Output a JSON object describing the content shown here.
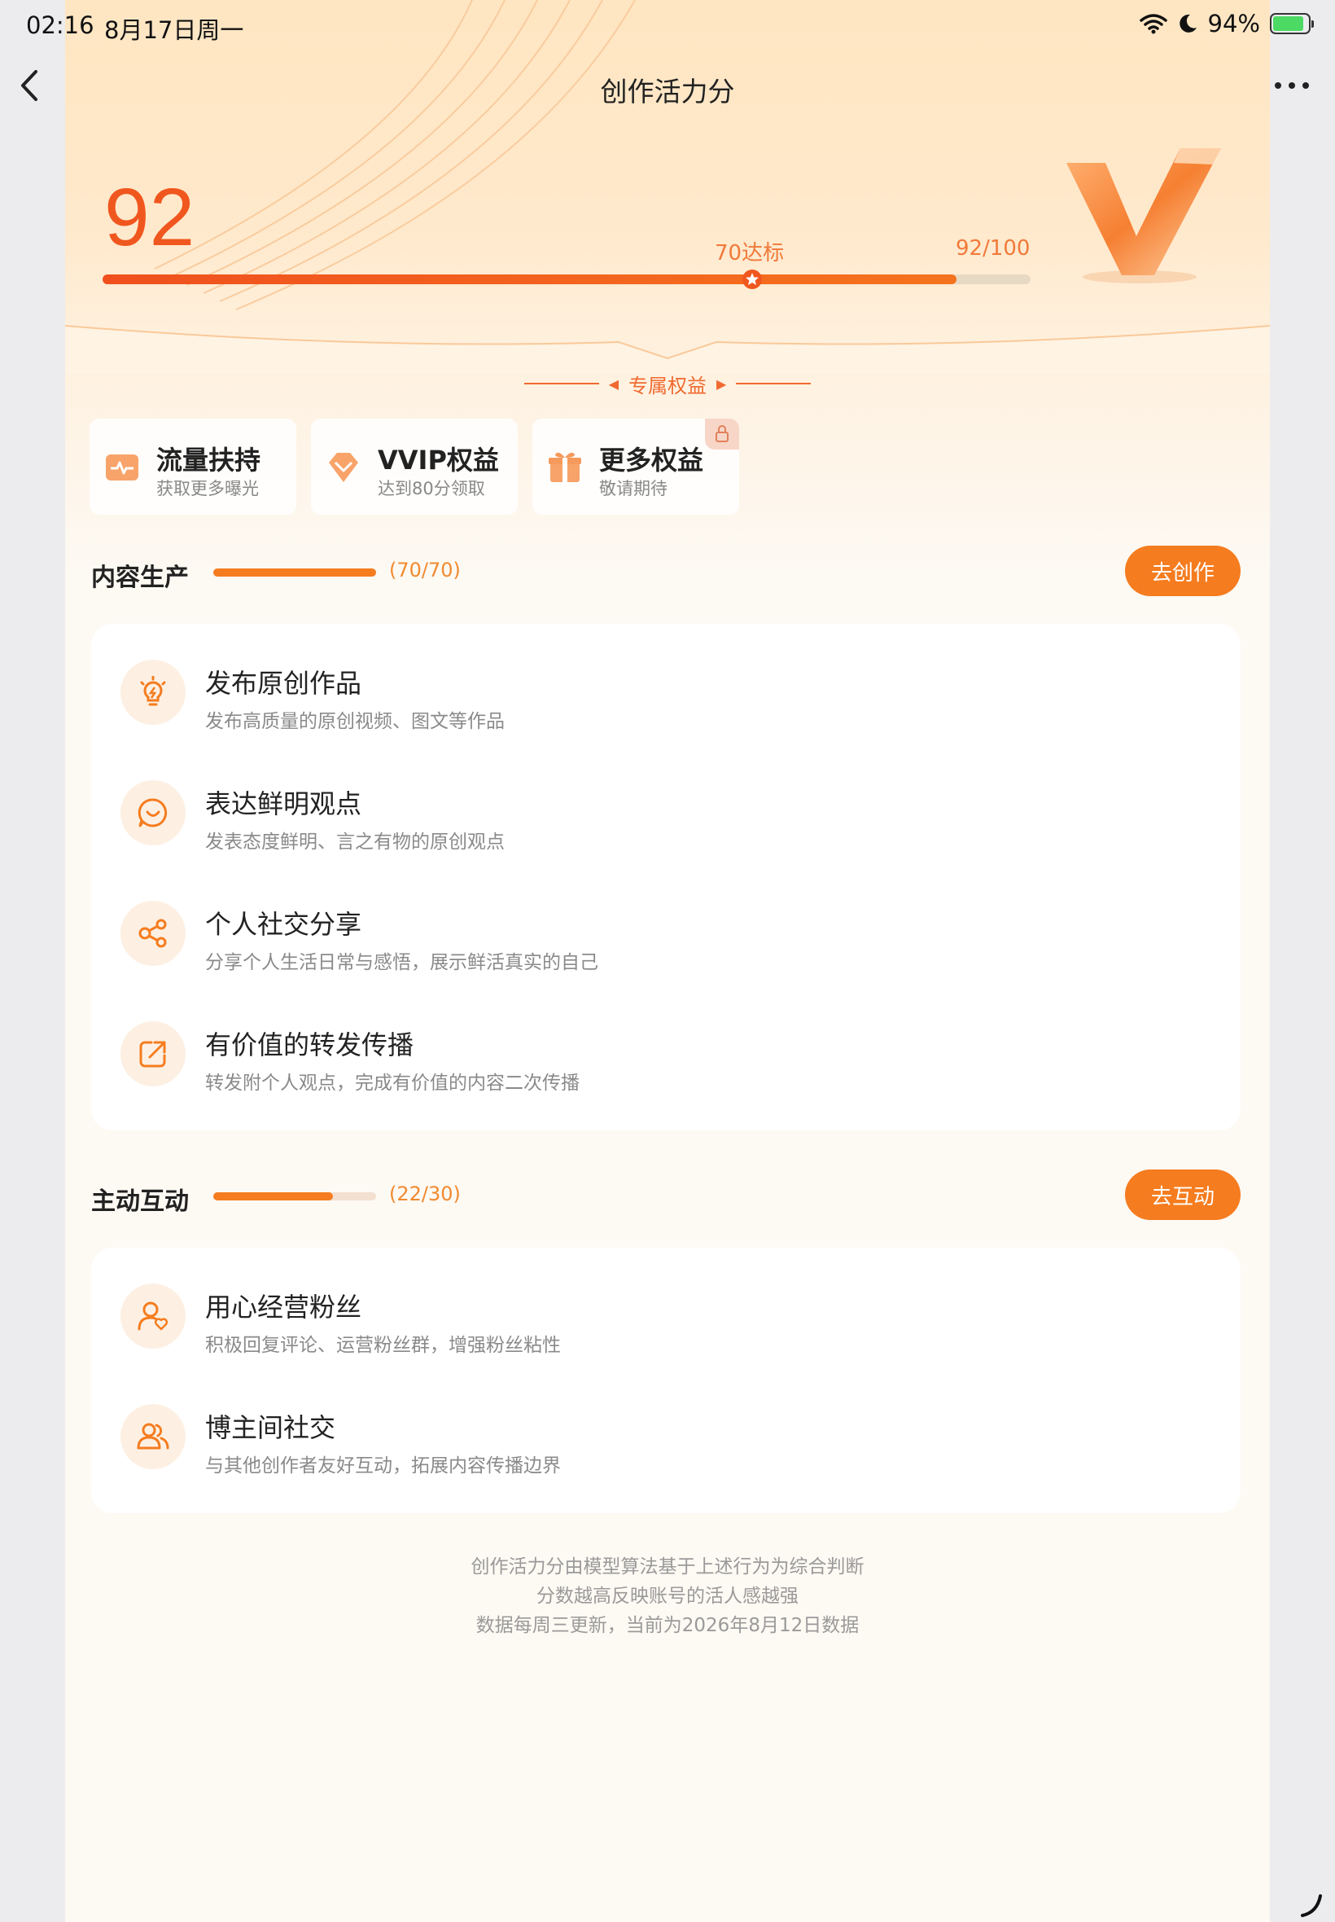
{
  "status_bar": {
    "time": "02:16",
    "date": "8月17日周一",
    "battery_pct": "94%"
  },
  "header": {
    "title": "创作活力分"
  },
  "score": {
    "value": "92",
    "progress": 0.92,
    "marker_label": "70达标",
    "marker_position": 0.7,
    "ratio": "92/100"
  },
  "benefits": {
    "title": "专属权益",
    "items": [
      {
        "name": "流量扶持",
        "desc": "获取更多曝光",
        "icon": "traffic-icon"
      },
      {
        "name": "VVIP权益",
        "desc": "达到80分领取",
        "icon": "diamond-icon"
      },
      {
        "name": "更多权益",
        "desc": "敬请期待",
        "icon": "gift-icon",
        "locked": true
      }
    ]
  },
  "sections": [
    {
      "title": "内容生产",
      "count": "(70/70)",
      "progress": 1.0,
      "button": "去创作",
      "items": [
        {
          "name": "发布原创作品",
          "desc": "发布高质量的原创视频、图文等作品",
          "icon": "lightbulb-icon"
        },
        {
          "name": "表达鲜明观点",
          "desc": "发表态度鲜明、言之有物的原创观点",
          "icon": "chat-smile-icon"
        },
        {
          "name": "个人社交分享",
          "desc": "分享个人生活日常与感悟，展示鲜活真实的自己",
          "icon": "share-icon"
        },
        {
          "name": "有价值的转发传播",
          "desc": "转发附个人观点，完成有价值的内容二次传播",
          "icon": "forward-icon"
        }
      ]
    },
    {
      "title": "主动互动",
      "count": "(22/30)",
      "progress": 0.7333,
      "button": "去互动",
      "items": [
        {
          "name": "用心经营粉丝",
          "desc": "积极回复评论、运营粉丝群，增强粉丝粘性",
          "icon": "user-heart-icon"
        },
        {
          "name": "博主间社交",
          "desc": "与其他创作者友好互动，拓展内容传播边界",
          "icon": "users-icon"
        }
      ]
    }
  ],
  "footnote": [
    "创作活力分由模型算法基于上述行为为综合判断",
    "分数越高反映账号的活人感越强",
    "数据每周三更新，当前为2026年8月12日数据"
  ],
  "colors": {
    "accent": "#f57c1f",
    "score": "#f0571e",
    "background": "#fdf9f3"
  }
}
